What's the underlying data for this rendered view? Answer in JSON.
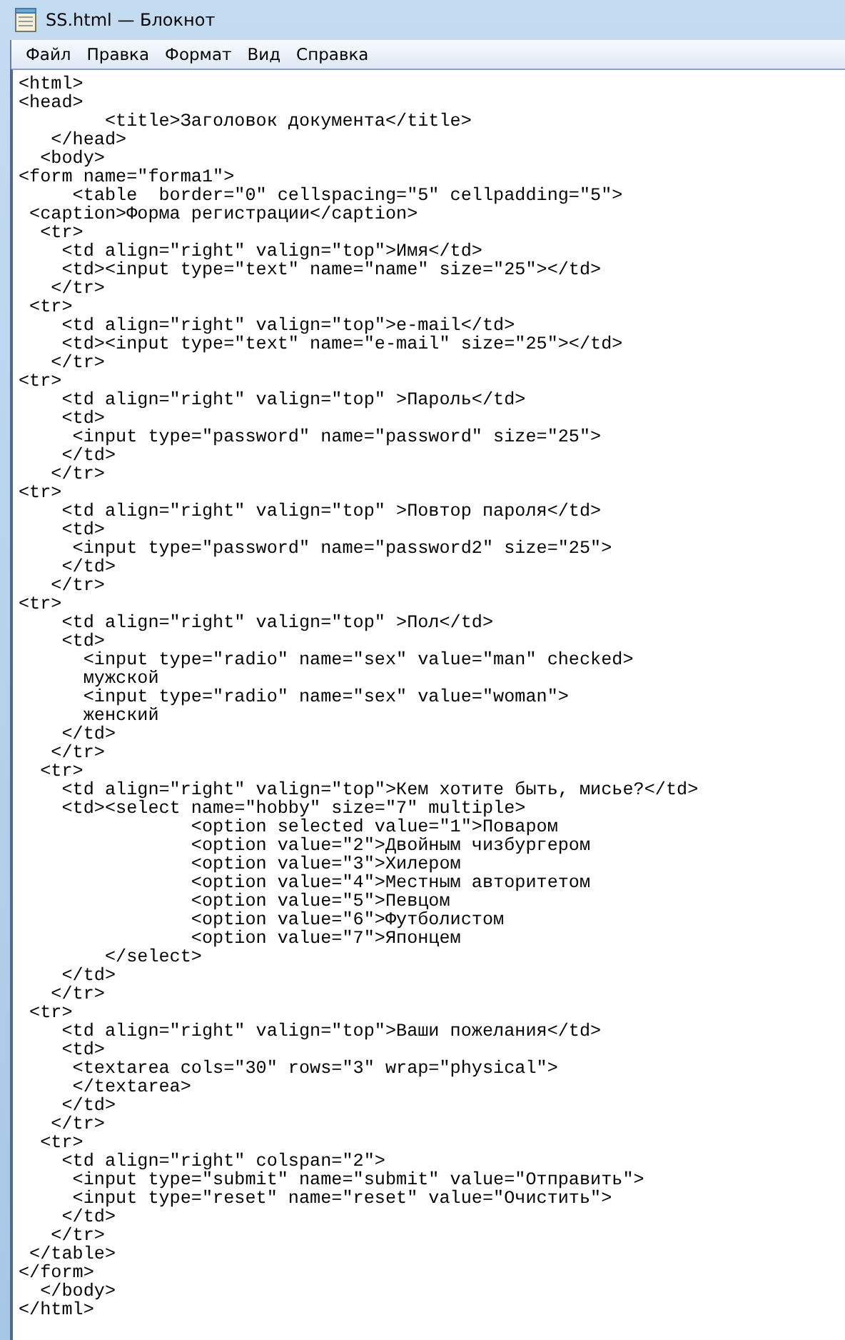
{
  "window": {
    "title": "SS.html — Блокнот"
  },
  "menu": [
    "Файл",
    "Правка",
    "Формат",
    "Вид",
    "Справка"
  ],
  "editor": {
    "lines": [
      "<html>",
      "<head>",
      "        <title>Заголовок документа</title>",
      "   </head>",
      "  <body>",
      "<form name=\"forma1\">",
      "     <table  border=\"0\" cellspacing=\"5\" cellpadding=\"5\">",
      " <caption>Форма регистрации</caption>",
      "  <tr>",
      "    <td align=\"right\" valign=\"top\">Имя</td>",
      "    <td><input type=\"text\" name=\"name\" size=\"25\"></td>",
      "   </tr>",
      " <tr>",
      "    <td align=\"right\" valign=\"top\">e-mail</td>",
      "    <td><input type=\"text\" name=\"e-mail\" size=\"25\"></td>",
      "   </tr>",
      "<tr>",
      "    <td align=\"right\" valign=\"top\" >Пароль</td>",
      "    <td>",
      "     <input type=\"password\" name=\"password\" size=\"25\">",
      "    </td>",
      "   </tr>",
      "<tr>",
      "    <td align=\"right\" valign=\"top\" >Повтор пароля</td>",
      "    <td>",
      "     <input type=\"password\" name=\"password2\" size=\"25\">",
      "    </td>",
      "   </tr>",
      "<tr>",
      "    <td align=\"right\" valign=\"top\" >Пол</td>",
      "    <td>",
      "      <input type=\"radio\" name=\"sex\" value=\"man\" checked>",
      "      мужской",
      "      <input type=\"radio\" name=\"sex\" value=\"woman\">",
      "      женский",
      "    </td>",
      "   </tr>",
      "  <tr>",
      "    <td align=\"right\" valign=\"top\">Кем хотите быть, мисье?</td>",
      "    <td><select name=\"hobby\" size=\"7\" multiple>",
      "                <option selected value=\"1\">Поваром",
      "                <option value=\"2\">Двойным чизбургером",
      "                <option value=\"3\">Хилером",
      "                <option value=\"4\">Местным авторитетом",
      "                <option value=\"5\">Певцом",
      "                <option value=\"6\">Футболистом",
      "                <option value=\"7\">Японцем",
      "        </select>",
      "    </td>",
      "   </tr>",
      " <tr>",
      "    <td align=\"right\" valign=\"top\">Ваши пожелания</td>",
      "    <td>",
      "     <textarea cols=\"30\" rows=\"3\" wrap=\"physical\">",
      "     </textarea>",
      "    </td>",
      "   </tr>",
      "  <tr>",
      "    <td align=\"right\" colspan=\"2\">",
      "     <input type=\"submit\" name=\"submit\" value=\"Отправить\">",
      "     <input type=\"reset\" name=\"reset\" value=\"Очистить\">",
      "    </td>",
      "   </tr>",
      " </table>",
      "</form>",
      "  </body>",
      "</html>"
    ]
  }
}
